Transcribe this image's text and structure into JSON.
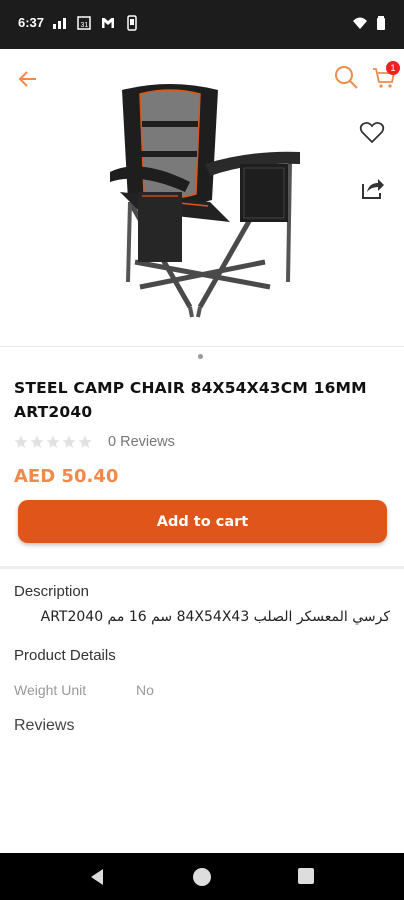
{
  "status_bar": {
    "time": "6:37"
  },
  "cart": {
    "badge_count": "1"
  },
  "product": {
    "title": "STEEL CAMP CHAIR 84X54X43CM 16MM ART2040",
    "rating_stars": 0,
    "reviews_count_text": "0 Reviews",
    "price": "AED 50.40",
    "add_to_cart_label": "Add to cart",
    "image_alt": "camp chair"
  },
  "details": {
    "description_label": "Description",
    "description_text": "كرسي المعسكر الصلب 84X54X43 سم 16 مم ART2040",
    "product_details_label": "Product Details",
    "weight_unit_label": "Weight Unit",
    "weight_unit_value": "No",
    "reviews_label": "Reviews"
  },
  "colors": {
    "accent": "#f08a4b",
    "button": "#e0551a",
    "status_bar": "#1c1c1c"
  },
  "icons": [
    "back-arrow-icon",
    "search-icon",
    "cart-icon",
    "heart-icon",
    "share-icon",
    "star-icon"
  ]
}
